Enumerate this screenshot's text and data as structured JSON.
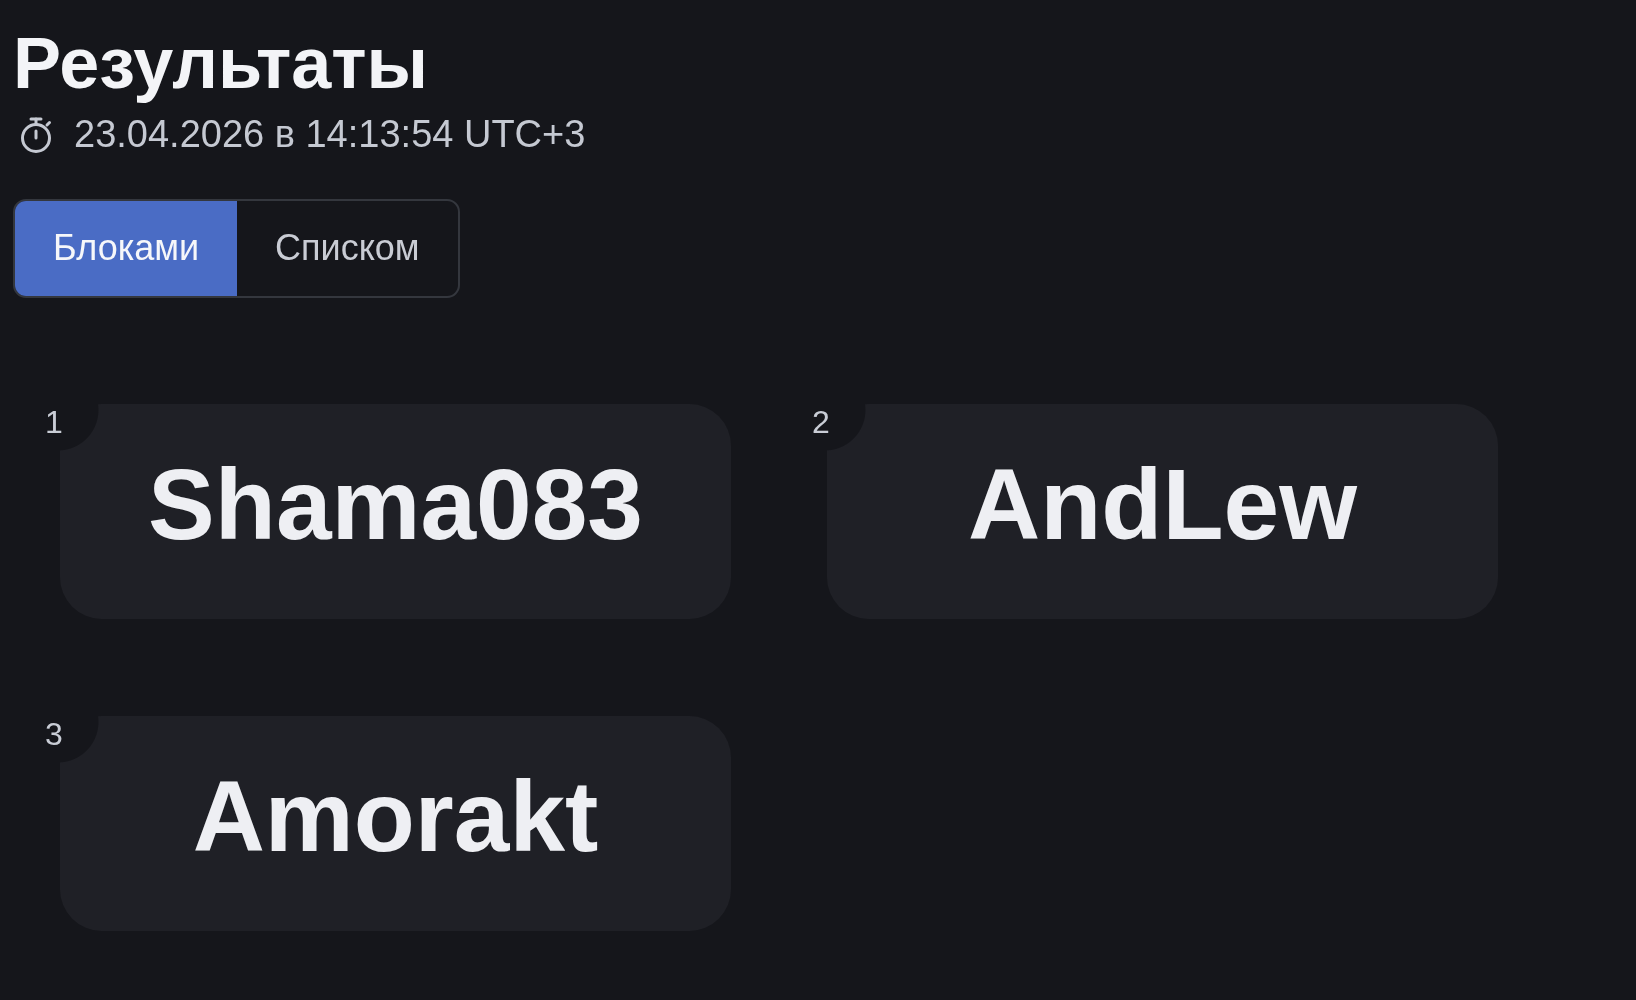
{
  "title": "Результаты",
  "timestamp": "23.04.2026 в 14:13:54 UTC+3",
  "view_tabs": [
    {
      "label": "Блоками",
      "selected": true
    },
    {
      "label": "Списком",
      "selected": false
    }
  ],
  "results": [
    {
      "rank": "1",
      "name": "Shama083"
    },
    {
      "rank": "2",
      "name": "AndLew"
    },
    {
      "rank": "3",
      "name": "Amorakt"
    }
  ]
}
